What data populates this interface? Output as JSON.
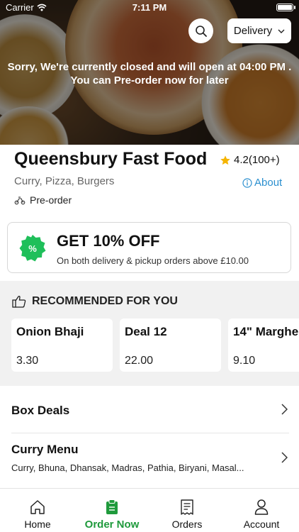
{
  "status_bar": {
    "carrier": "Carrier",
    "time": "7:11 PM"
  },
  "header": {
    "search_icon": "search-icon",
    "delivery_mode": "Delivery",
    "closed_message_line1": "Sorry, We're currently closed and will open at 04:00 PM .",
    "closed_message_line2": "You can Pre-order now for later"
  },
  "restaurant": {
    "name": "Queensbury Fast Food",
    "rating": "4.2(100+)",
    "cuisines": "Curry, Pizza, Burgers",
    "about_label": "About",
    "order_mode": "Pre-order"
  },
  "offer": {
    "title": "GET 10% OFF",
    "subtitle": "On both delivery & pickup orders above £10.00",
    "badge_color": "#1fbf5a"
  },
  "recommended": {
    "heading": "RECOMMENDED FOR YOU",
    "items": [
      {
        "name": "Onion Bhaji",
        "price": "3.30"
      },
      {
        "name": "Deal 12",
        "price": "22.00"
      },
      {
        "name": "14\" Marghe",
        "price": "9.10"
      }
    ]
  },
  "menu": [
    {
      "title": "Box Deals",
      "description": ""
    },
    {
      "title": "Curry Menu",
      "description": "Curry, Bhuna, Dhansak, Madras, Pathia, Biryani, Masal..."
    }
  ],
  "tabs": [
    {
      "label": "Home",
      "icon": "home-icon"
    },
    {
      "label": "Order Now",
      "icon": "order-bag-icon"
    },
    {
      "label": "Orders",
      "icon": "receipt-icon"
    },
    {
      "label": "Account",
      "icon": "user-icon"
    }
  ],
  "colors": {
    "accent": "#1f9a3c",
    "link": "#2b8fcf",
    "star": "#f5b400"
  }
}
